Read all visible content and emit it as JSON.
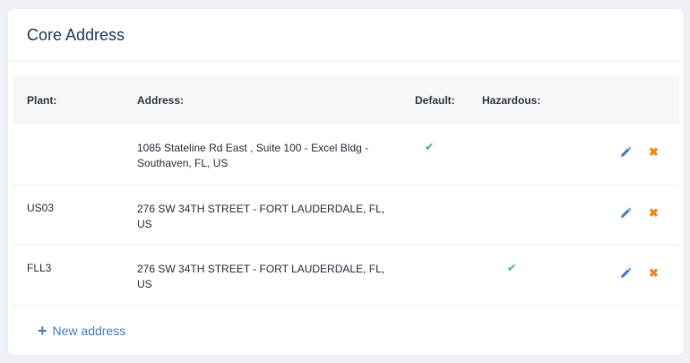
{
  "card": {
    "title": "Core Address"
  },
  "table": {
    "headers": {
      "plant": "Plant:",
      "address": "Address:",
      "default": "Default:",
      "hazardous": "Hazardous:"
    },
    "rows": [
      {
        "plant": "",
        "address": "1085 Stateline Rd East , Suite 100 - Excel Bldg - Southaven, FL, US",
        "default": true,
        "hazardous": false
      },
      {
        "plant": "US03",
        "address": "276 SW 34TH STREET - FORT LAUDERDALE, FL, US",
        "default": false,
        "hazardous": false
      },
      {
        "plant": "FLL3",
        "address": "276 SW 34TH STREET - FORT LAUDERDALE, FL, US",
        "default": false,
        "hazardous": true
      }
    ]
  },
  "actions": {
    "new_address_label": "New address",
    "check_glyph": "✔",
    "delete_glyph": "✖",
    "plus_glyph": "+"
  },
  "colors": {
    "title": "#24416b",
    "check": "#5fbf8a",
    "edit": "#4a7ec0",
    "delete": "#e8891c",
    "link": "#4a7ec0"
  },
  "icons": {
    "check": "check-icon",
    "edit": "pencil-icon",
    "delete": "close-icon",
    "add": "plus-icon"
  }
}
